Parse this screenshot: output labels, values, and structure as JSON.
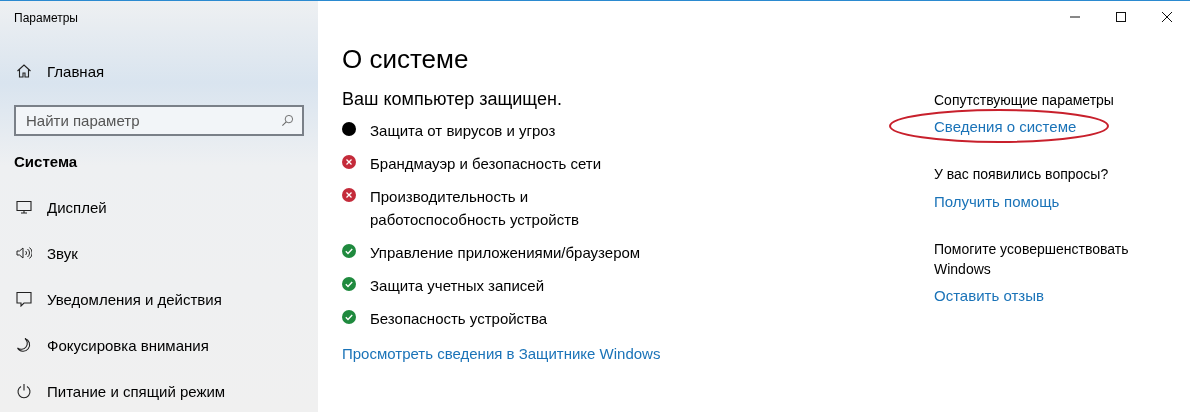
{
  "window": {
    "title": "Параметры"
  },
  "sidebar": {
    "home": "Главная",
    "search": {
      "placeholder": "Найти параметр"
    },
    "section": "Система",
    "items": [
      {
        "label": "Дисплей"
      },
      {
        "label": "Звук"
      },
      {
        "label": "Уведомления и действия"
      },
      {
        "label": "Фокусировка внимания"
      },
      {
        "label": "Питание и спящий режим"
      }
    ]
  },
  "page": {
    "title": "О системе",
    "subtitle": "Ваш компьютер защищен.",
    "statuses": [
      {
        "label": "Защита от вирусов и угроз",
        "kind": "dot"
      },
      {
        "label": "Брандмауэр и безопасность сети",
        "kind": "error"
      },
      {
        "label": "Производительность и работоспособность устройств",
        "kind": "error"
      },
      {
        "label": "Управление приложениями/браузером",
        "kind": "ok"
      },
      {
        "label": "Защита учетных записей",
        "kind": "ok"
      },
      {
        "label": "Безопасность устройства",
        "kind": "ok"
      }
    ],
    "link": "Просмотреть сведения в Защитнике Windows"
  },
  "related": [
    {
      "heading": "Сопутствующие параметры",
      "link": "Сведения о системе",
      "circled": true
    },
    {
      "heading": "У вас появились вопросы?",
      "link": "Получить помощь",
      "circled": false
    },
    {
      "heading": "Помогите усовершенствовать Windows",
      "link": "Оставить отзыв",
      "circled": false
    }
  ]
}
